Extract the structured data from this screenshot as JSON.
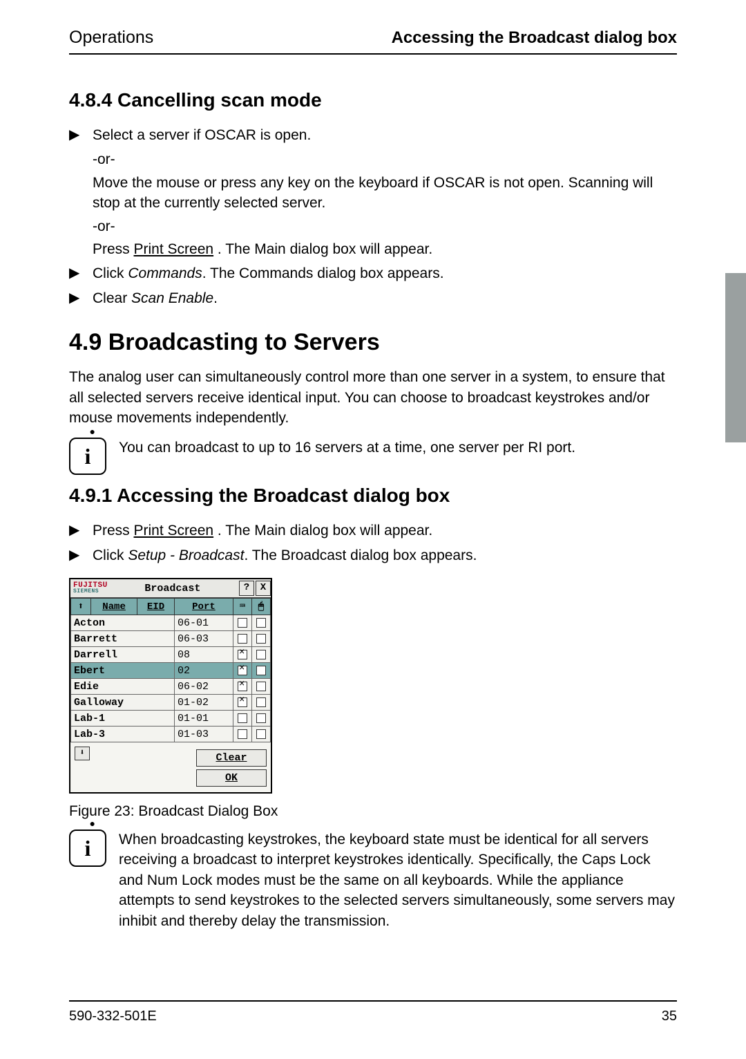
{
  "header": {
    "left": "Operations",
    "right": "Accessing the Broadcast dialog box"
  },
  "s484": {
    "heading": "4.8.4  Cancelling scan mode",
    "b1a": "Select a server if OSCAR is open.",
    "or": "-or-",
    "b1b": "Move the mouse or press any key on the keyboard if OSCAR is not open. Scanning will stop at the currently selected server.",
    "b1c_pre": "Press ",
    "b1c_key": "Print Screen",
    "b1c_post": " . The Main dialog box will appear.",
    "b2_pre": "Click ",
    "b2_it": "Commands",
    "b2_post": ". The Commands dialog box appears.",
    "b3_pre": "Clear ",
    "b3_it": "Scan Enable",
    "b3_post": "."
  },
  "s49": {
    "heading": "4.9    Broadcasting to Servers",
    "para": "The analog user can simultaneously control more than one server in a system, to ensure that all selected servers receive identical input. You can choose to broadcast keystrokes and/or mouse movements independently.",
    "info": "You can broadcast to up to 16 servers at a time, one server per RI port."
  },
  "s491": {
    "heading": "4.9.1  Accessing the Broadcast dialog box",
    "b1_pre": "Press ",
    "b1_key": "Print Screen",
    "b1_post": " . The Main dialog box will appear.",
    "b2_pre": "Click ",
    "b2_it": "Setup - Broadcast",
    "b2_post": ". The Broadcast dialog box appears."
  },
  "dialog": {
    "brand": "FUJITSU",
    "brand_sub": "SIEMENS",
    "title": "Broadcast",
    "help": "?",
    "close": "X",
    "col_name": "Name",
    "col_eid": "EID",
    "col_port": "Port",
    "rows": [
      {
        "name": "Acton",
        "port": "06-01",
        "k": false,
        "m": false,
        "sel": false
      },
      {
        "name": "Barrett",
        "port": "06-03",
        "k": false,
        "m": false,
        "sel": false
      },
      {
        "name": "Darrell",
        "port": "08",
        "k": true,
        "m": false,
        "sel": false
      },
      {
        "name": "Ebert",
        "port": "02",
        "k": true,
        "m": false,
        "sel": true
      },
      {
        "name": "Edie",
        "port": "06-02",
        "k": true,
        "m": false,
        "sel": false
      },
      {
        "name": "Galloway",
        "port": "01-02",
        "k": true,
        "m": false,
        "sel": false
      },
      {
        "name": "Lab-1",
        "port": "01-01",
        "k": false,
        "m": false,
        "sel": false
      },
      {
        "name": "Lab-3",
        "port": "01-03",
        "k": false,
        "m": false,
        "sel": false
      }
    ],
    "btn_clear": "Clear",
    "btn_ok": "OK"
  },
  "fig_caption": "Figure 23: Broadcast Dialog Box",
  "info2": "When broadcasting keystrokes, the keyboard state must be identical for all servers receiving a broadcast to interpret keystrokes identically. Specifically, the Caps Lock and Num Lock modes must be the same on all keyboards. While the appliance attempts to send keystrokes to the selected servers simultaneously, some servers may inhibit and thereby delay the transmission.",
  "footer": {
    "left": "590-332-501E",
    "right": "35"
  }
}
